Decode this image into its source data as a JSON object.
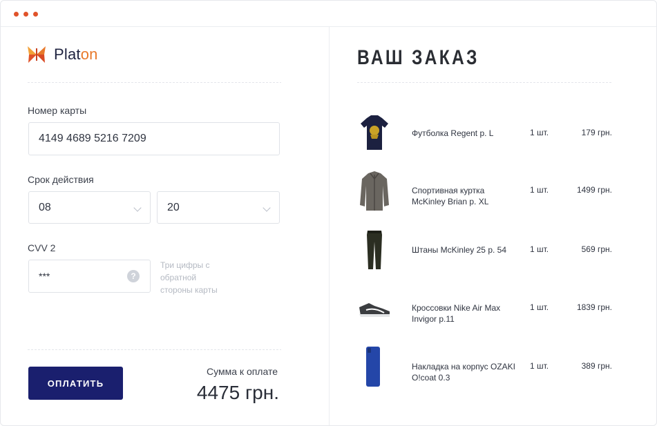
{
  "window": {
    "dots": [
      "red",
      "red",
      "red"
    ]
  },
  "brand": {
    "name_main": "Plat",
    "name_accent": "on",
    "logo_icon": "butterfly-logo-icon",
    "accent_color": "#e8792b"
  },
  "form": {
    "card_number_label": "Номер карты",
    "card_number_value": "4149 4689 5216 7209",
    "expiry_label": "Срок действия",
    "expiry_month": "08",
    "expiry_year": "20",
    "cvv_label": "CVV 2",
    "cvv_value": "***",
    "cvv_help_icon": "?",
    "cvv_hint": "Три цифры с обратной стороны карты",
    "pay_button": "ОПЛАТИТЬ",
    "sum_label": "Сумма к оплате",
    "sum_value": "4475 грн."
  },
  "order": {
    "title": "ВАШ ЗАКАЗ",
    "items": [
      {
        "name": "Футболка Regent р. L",
        "qty": "1 шт.",
        "price": "179 грн.",
        "icon": "tshirt-icon"
      },
      {
        "name": "Спортивная куртка McKinley Brian р. XL",
        "qty": "1 шт.",
        "price": "1499 грн.",
        "icon": "jacket-icon"
      },
      {
        "name": "Штаны McKinley 25 р. 54",
        "qty": "1 шт.",
        "price": "569 грн.",
        "icon": "pants-icon"
      },
      {
        "name": "Кроссовки Nike Air Max Invigor р.11",
        "qty": "1 шт.",
        "price": "1839 грн.",
        "icon": "sneaker-icon"
      },
      {
        "name": "Накладка на корпус OZAKI O!coat 0.3",
        "qty": "1 шт.",
        "price": "389 грн.",
        "icon": "phone-case-icon"
      }
    ]
  },
  "colors": {
    "primary_button": "#1a1f6e",
    "window_dots": "#e0532a"
  }
}
